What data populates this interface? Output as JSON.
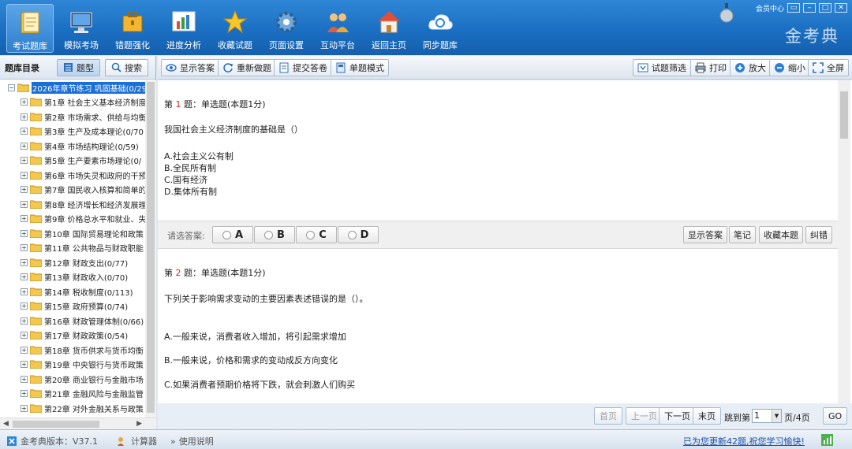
{
  "nav": {
    "items": [
      {
        "label": "考试题库",
        "icon": "book-icon"
      },
      {
        "label": "模拟考场",
        "icon": "monitor-icon"
      },
      {
        "label": "错题强化",
        "icon": "briefcase-icon"
      },
      {
        "label": "进度分析",
        "icon": "chart-icon"
      },
      {
        "label": "收藏试题",
        "icon": "star-icon"
      },
      {
        "label": "页面设置",
        "icon": "gear-icon"
      },
      {
        "label": "互动平台",
        "icon": "people-icon"
      },
      {
        "label": "返回主页",
        "icon": "home-icon"
      },
      {
        "label": "同步题库",
        "icon": "cloud-sync-icon"
      }
    ],
    "member_center": "会员中心",
    "brand": "金考典"
  },
  "sidebar": {
    "title": "题库目录",
    "tab_questions": "题型",
    "tab_search": "搜索",
    "tree": {
      "root": "2026年章节练习 巩固基础(0/29",
      "children": [
        "第1章 社会主义基本经济制度",
        "第2章 市场需求、供给与均衡",
        "第3章 生产及成本理论(0/70",
        "第4章 市场结构理论(0/59)",
        "第5章 生产要素市场理论(0/",
        "第6章 市场失灵和政府的干预",
        "第7章 国民收入核算和简单的",
        "第8章 经济增长和经济发展理",
        "第9章 价格总水平和就业、失",
        "第10章 国际贸易理论和政策",
        "第11章 公共物品与财政职能",
        "第12章 财政支出(0/77)",
        "第13章 财政收入(0/70)",
        "第14章 税收制度(0/113)",
        "第15章 政府预算(0/74)",
        "第16章 财政管理体制(0/66)",
        "第17章 财政政策(0/54)",
        "第18章 货币供求与货币均衡",
        "第19章 中央银行与货币政策",
        "第20章 商业银行与金融市场",
        "第21章 金融风险与金融监管",
        "第22章 对外金融关系与政策"
      ]
    }
  },
  "toolbar": {
    "show_answer": "显示答案",
    "redo": "重新做题",
    "submit": "提交答卷",
    "single_mode": "单题模式",
    "filter": "试题筛选",
    "print": "打印",
    "zoom_in": "放大",
    "zoom_out": "缩小",
    "fullscreen": "全屏"
  },
  "questions": [
    {
      "prefix": "第",
      "number": "1",
      "suffix": "题：单选题(本题1分)",
      "text": "我国社会主义经济制度的基础是（）",
      "options": [
        "A.社会主义公有制",
        "B.全民所有制",
        "C.国有经济",
        "D.集体所有制"
      ]
    },
    {
      "prefix": "第",
      "number": "2",
      "suffix": "题：单选题(本题1分)",
      "text": "下列关于影响需求变动的主要因素表述错误的是（）。",
      "options": [
        "A.一般来说，消费者收入增加，将引起需求增加",
        "B.一般来说，价格和需求的变动成反方向变化",
        "C.如果消费者预期价格将下跌，就会刺激人们购买"
      ]
    }
  ],
  "answer_bar": {
    "label": "请选答案:",
    "choices": [
      "A",
      "B",
      "C",
      "D"
    ],
    "show_answer": "显示答案",
    "notes": "笔记",
    "favorite": "收藏本题",
    "report_error": "纠错"
  },
  "pager": {
    "first": "首页",
    "prev": "上一页",
    "next": "下一页",
    "last": "末页",
    "goto_label": "跳到第",
    "current_page": "1",
    "total": "页/4页",
    "go": "GO"
  },
  "status": {
    "version": "金考典版本：V37.1",
    "calculator": "计算器",
    "help": "使用说明",
    "update_notice": "已为您更新42题,祝您学习愉快!"
  }
}
